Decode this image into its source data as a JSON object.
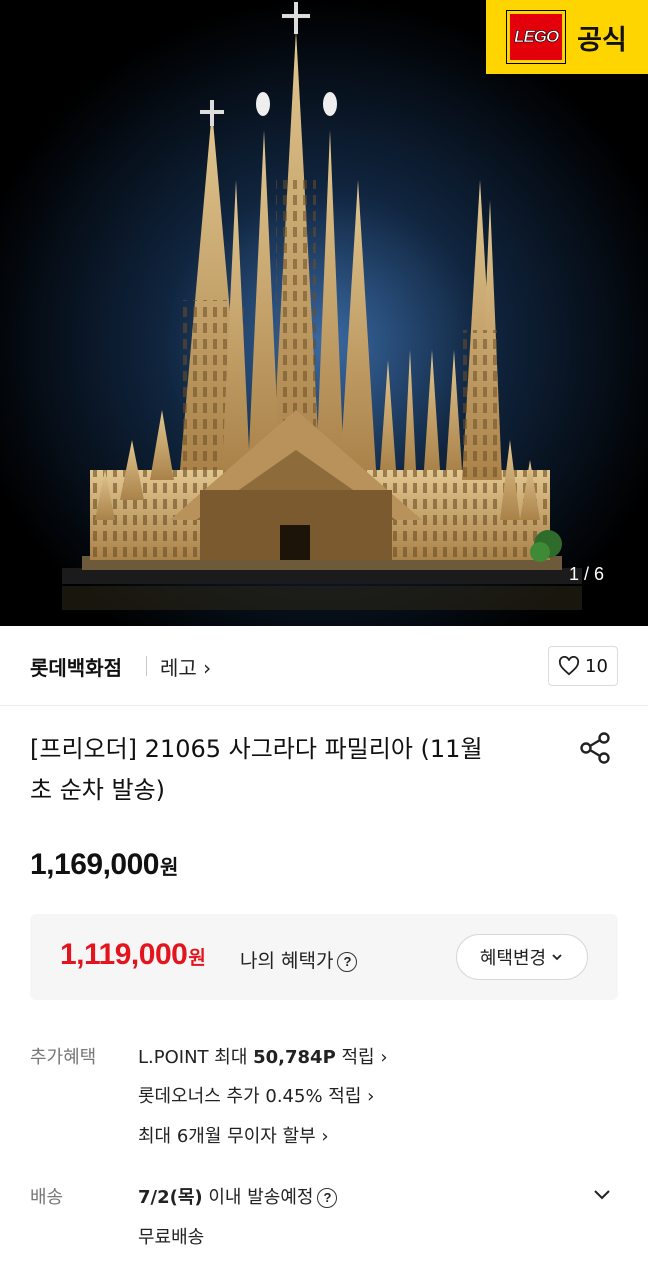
{
  "hero": {
    "badge_logo_text": "LEGO",
    "badge_label": "공식",
    "image_index": "1 / 6"
  },
  "store": {
    "name": "롯데백화점",
    "brand_label": "레고 ›",
    "like_count": "10"
  },
  "product": {
    "title_line1": "[프리오더] 21065 사그라다 파밀리아 (11월",
    "title_line2": "초 순차 발송)",
    "price": "1,169,000",
    "currency": "원"
  },
  "benefit": {
    "price": "1,119,000",
    "currency": "원",
    "label": "나의 혜택가",
    "change_button": "혜택변경"
  },
  "extra": {
    "label": "추가혜택",
    "items": [
      {
        "pre": "L.POINT 최대 ",
        "bold": "50,784P",
        "post": " 적립 ›"
      },
      {
        "pre": "롯데오너스 추가 0.45% 적립 ›",
        "bold": "",
        "post": ""
      },
      {
        "pre": "최대 6개월 무이자 할부 ›",
        "bold": "",
        "post": ""
      }
    ]
  },
  "shipping": {
    "label": "배송",
    "date_bold": "7/2(목)",
    "date_rest": " 이내 발송예정",
    "fee": "무료배송"
  },
  "colors": {
    "accent_red": "#e4141e",
    "lego_red": "#e3000b",
    "badge_yellow": "#ffd500",
    "box_bg": "#f6f6f6",
    "sand": "#c9a56c"
  },
  "icons": [
    "heart-icon",
    "share-icon",
    "question-icon",
    "chevron-down-icon",
    "chevron-right-icon"
  ]
}
